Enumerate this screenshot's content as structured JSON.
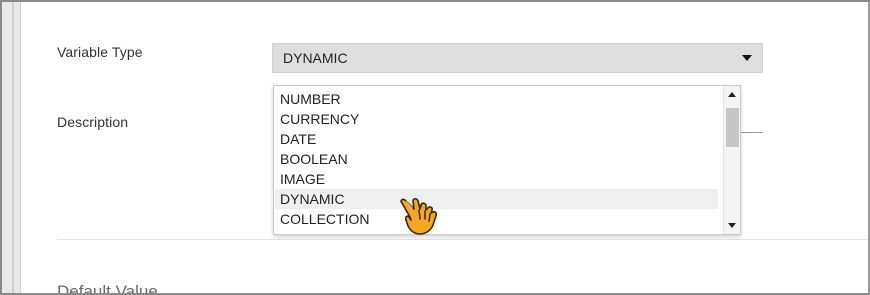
{
  "form": {
    "variable_type_label": "Variable Type",
    "variable_type_value": "DYNAMIC",
    "description_label": "Description",
    "default_value_title": "Default Value"
  },
  "dropdown": {
    "options": [
      "NUMBER",
      "CURRENCY",
      "DATE",
      "BOOLEAN",
      "IMAGE",
      "DYNAMIC",
      "COLLECTION"
    ],
    "hovered": "DYNAMIC"
  },
  "icons": {
    "select_caret": "caret-down-icon",
    "scroll_up": "scroll-up-arrow-icon",
    "scroll_down": "scroll-down-arrow-icon",
    "pointer": "hand-pointer-icon"
  },
  "colors": {
    "select_bg": "#dedede",
    "hover_bg": "#efefef",
    "pointer_fill": "#f5a623",
    "pointer_outline": "#3a2a00"
  }
}
